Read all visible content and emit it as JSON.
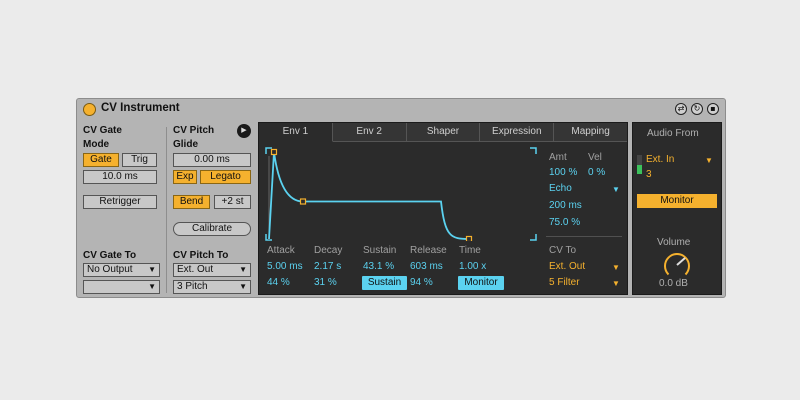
{
  "device": {
    "title": "CV Instrument",
    "buttons": [
      "hot-swap",
      "save-preset",
      "fold"
    ]
  },
  "gate": {
    "label": "CV Gate",
    "mode_label": "Mode",
    "gate": "Gate",
    "trig": "Trig",
    "length": "10.0 ms",
    "retrigger": "Retrigger",
    "to_label": "CV Gate To",
    "output": "No Output",
    "sub_output": ""
  },
  "pitch": {
    "label": "CV Pitch",
    "glide_label": "Glide",
    "glide": "0.00 ms",
    "exp": "Exp",
    "legato": "Legato",
    "bend": "Bend",
    "bend_range": "+2 st",
    "calibrate": "Calibrate",
    "to_label": "CV Pitch To",
    "output": "Ext. Out",
    "channel": "3 Pitch"
  },
  "tabs": [
    {
      "label": "Env 1",
      "active": true
    },
    {
      "label": "Env 2",
      "active": false
    },
    {
      "label": "Shaper",
      "active": false
    },
    {
      "label": "Expression",
      "active": false
    },
    {
      "label": "Mapping",
      "active": false
    }
  ],
  "envelope": {
    "attack_label": "Attack",
    "attack": "5.00 ms",
    "attack_slope": "44 %",
    "decay_label": "Decay",
    "decay": "2.17 s",
    "decay_slope": "31 %",
    "sustain_label": "Sustain",
    "sustain": "43.1 %",
    "sustain_mode": "Sustain",
    "release_label": "Release",
    "release": "603 ms",
    "release_slope": "94 %",
    "time_label": "Time",
    "time": "1.00 x",
    "monitor": "Monitor"
  },
  "mod": {
    "amt_label": "Amt",
    "amt": "100 %",
    "vel_label": "Vel",
    "vel": "0 %",
    "mode": "Echo",
    "echo_time": "200 ms",
    "echo_feedback": "75.0 %",
    "cv_to_label": "CV To",
    "cv_output": "Ext. Out",
    "cv_channel": "5 Filter"
  },
  "audio": {
    "label": "Audio From",
    "input": "Ext. In",
    "channel": "3",
    "input_level": 0.5,
    "monitor": "Monitor",
    "volume_label": "Volume",
    "volume": "0.0 dB"
  },
  "colors": {
    "accent": "#f5b12e",
    "cyan": "#5bd2f0",
    "panel": "#2b2b2b",
    "device_bg": "#b4b4b4"
  }
}
